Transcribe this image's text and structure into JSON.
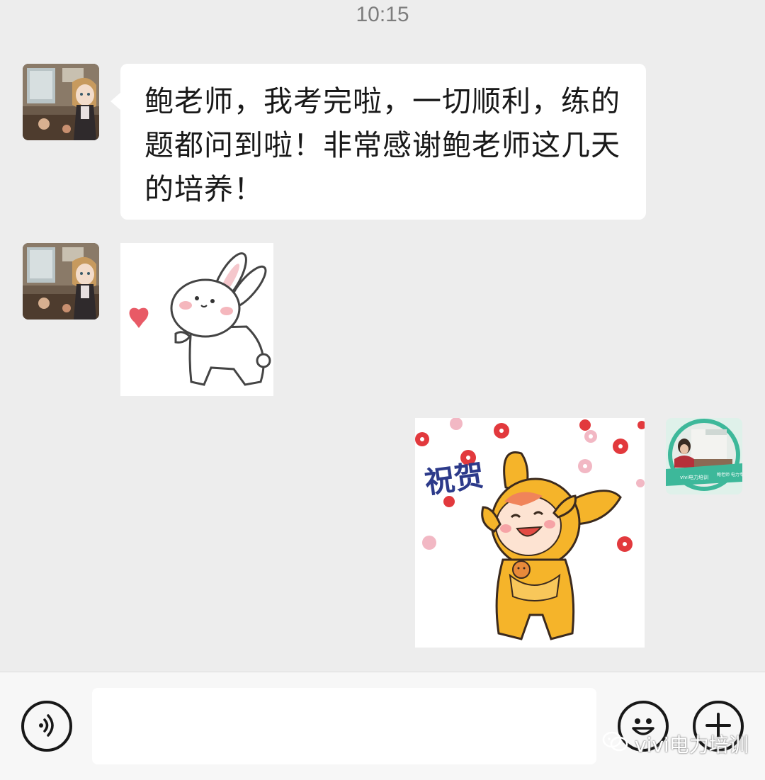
{
  "status": {
    "time": "10:15"
  },
  "messages": [
    {
      "side": "left",
      "type": "text",
      "avatar": "anime-girl-avatar",
      "text": "鲍老师，我考完啦，一切顺利，练的题都问到啦！非常感谢鲍老师这几天的培养！"
    },
    {
      "side": "left",
      "type": "sticker",
      "avatar": "anime-girl-avatar",
      "sticker": "bunny-heart-sticker"
    },
    {
      "side": "right",
      "type": "sticker",
      "avatar": "teacher-avatar",
      "sticker": "congrats-kangaroo-sticker",
      "sticker_text": "祝贺"
    }
  ],
  "teacher_avatar": {
    "banner_left": "vivi电力培训",
    "banner_right": "鲍老师 电力专家"
  },
  "input_bar": {
    "placeholder": "",
    "voice_icon": "voice-icon",
    "emoji_icon": "emoji-icon",
    "plus_icon": "plus-icon"
  },
  "watermark": {
    "text": "vivi电力培训",
    "icon": "wechat-icon"
  },
  "colors": {
    "background": "#ededed",
    "bubble": "#ffffff",
    "input_bar": "#f7f7f7",
    "teacher_badge": "#3db89a"
  }
}
